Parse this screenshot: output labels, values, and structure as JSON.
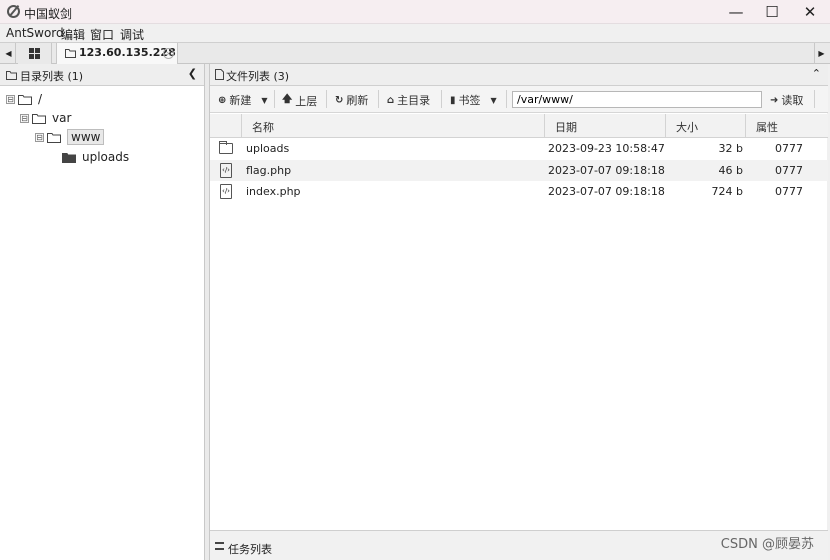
{
  "window": {
    "title": "中国蚁剑",
    "minimize": "—",
    "maximize": "☐",
    "close": "✕"
  },
  "menu": [
    "AntSword",
    "编辑",
    "窗口",
    "调试"
  ],
  "tabs": {
    "active_label": "123.60.135.228",
    "left_arrow": "◀",
    "right_arrow": "▶",
    "close": "×"
  },
  "left_panel": {
    "title": "目录列表 (1)",
    "collapse": "❮",
    "tree": [
      {
        "label": "/",
        "expander": "⊟"
      },
      {
        "label": "var",
        "expander": "⊟"
      },
      {
        "label": "www",
        "expander": "⊟"
      },
      {
        "label": "uploads",
        "expander": ""
      }
    ]
  },
  "right_panel": {
    "title": "文件列表 (3)",
    "collapse": "⌃",
    "toolbar": {
      "new": "新建",
      "up": "上层",
      "refresh": "刷新",
      "home": "主目录",
      "bookmark": "书签",
      "path": "/var/www/",
      "read": "读取"
    },
    "columns": [
      "名称",
      "日期",
      "大小",
      "属性"
    ],
    "files": [
      {
        "name": "uploads",
        "date": "2023-09-23 10:58:47",
        "size": "32 b",
        "perm": "0777",
        "type": "folder"
      },
      {
        "name": "flag.php",
        "date": "2023-07-07 09:18:18",
        "size": "46 b",
        "perm": "0777",
        "type": "php"
      },
      {
        "name": "index.php",
        "date": "2023-07-07 09:18:18",
        "size": "724 b",
        "perm": "0777",
        "type": "php"
      }
    ]
  },
  "task_bar": {
    "title": "任务列表"
  },
  "watermark": "CSDN @顾晏苏"
}
